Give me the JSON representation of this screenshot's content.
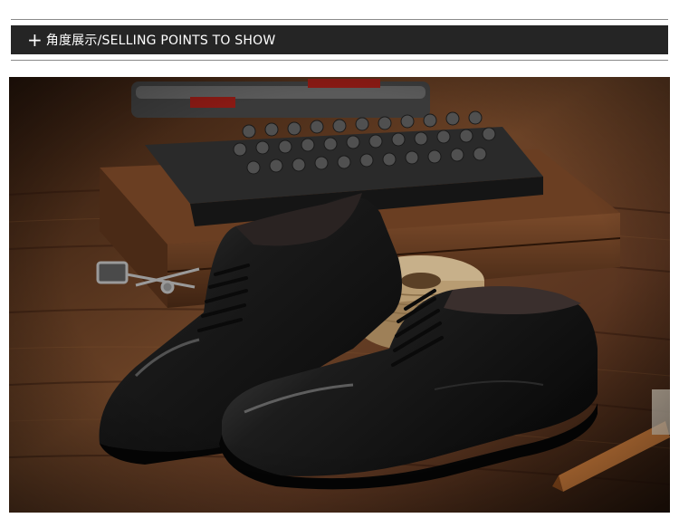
{
  "header": {
    "plus_glyph": "+",
    "title": "角度展示/SELLING POINTS TO SHOW"
  },
  "photo": {
    "subject": "product-photo-black-leather-derby-shoes",
    "colors": {
      "header_bg": "#252525",
      "wood": "#5a3620",
      "leather": "#141414"
    }
  }
}
